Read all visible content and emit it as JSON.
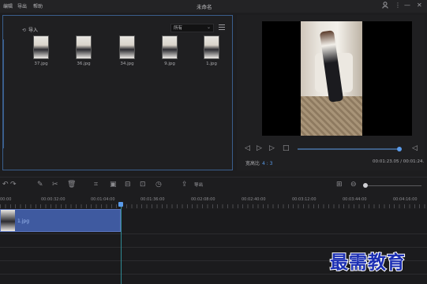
{
  "menu": [
    "编辑",
    "导出",
    "帮助"
  ],
  "window_title": "未命名",
  "window_controls": [
    "user-icon",
    "more-icon",
    "minimize-icon",
    "close-icon"
  ],
  "media": {
    "import_label": "导入",
    "filter_value": "所有",
    "files": [
      {
        "name": "37.jpg"
      },
      {
        "name": "36.jpg"
      },
      {
        "name": "34.jpg"
      },
      {
        "name": "9.jpg"
      },
      {
        "name": "1.jpg"
      }
    ]
  },
  "preview": {
    "ratio_label": "宽高比",
    "ratio_value": "4 : 3",
    "timecode": "00:01:23.05 / 00:01:24.",
    "progress": 0.98
  },
  "toolbar": {
    "export_label": "导出"
  },
  "timeline": {
    "ruler": [
      "00:00",
      "00:00:32:00",
      "00:01:04:00",
      "00:01:36:00",
      "00:02:08:00",
      "00:02:40:00",
      "00:03:12:00",
      "00:03:44:00",
      "00:04:16:00"
    ],
    "clip_label": "1.jpg"
  },
  "watermark": "最需教育",
  "colors": {
    "accent": "#5a9bea",
    "clip": "#3f5aa0",
    "playhead": "#2f8a93",
    "panel_border": "#3a5e8c",
    "watermark": "#1c2fb3"
  }
}
